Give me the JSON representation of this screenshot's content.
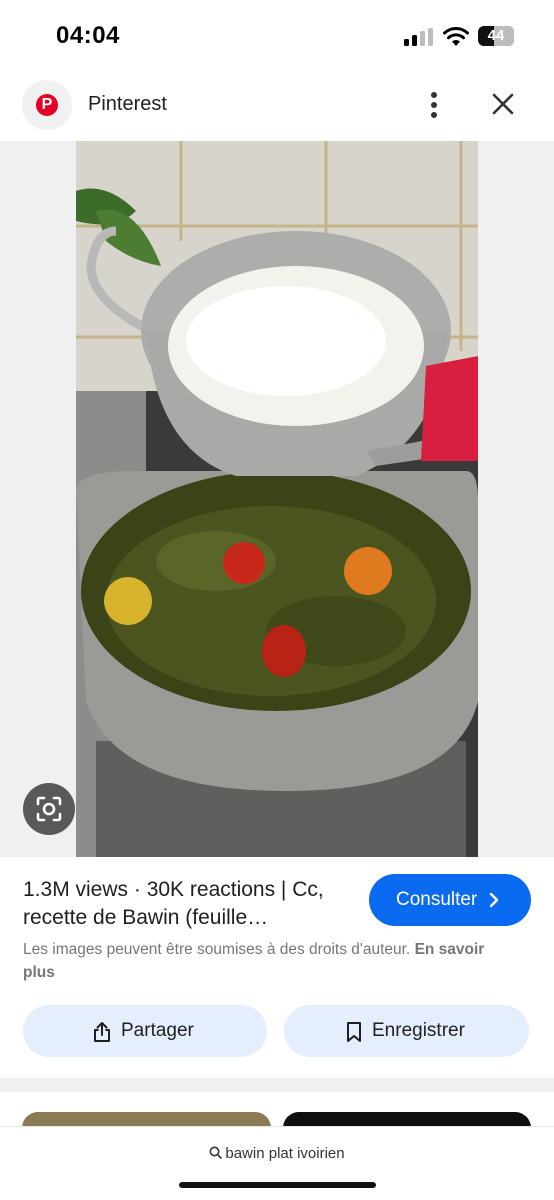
{
  "status_bar": {
    "time": "04:04",
    "battery": "44",
    "battery_level_percent": 44
  },
  "header": {
    "title": "Pinterest",
    "logo_icon": "pinterest-logo-icon",
    "menu_icon": "more-vertical-icon",
    "close_icon": "close-icon"
  },
  "image": {
    "description_icon": "visual-search-lens-icon"
  },
  "pin": {
    "title": "1.3M views · 30K reactions | Cc, recette de Bawin (feuille…",
    "consult_label": "Consulter",
    "copyright_text": "Les images peuvent être soumises à des droits d'auteur.",
    "learn_more_label": "En savoir plus"
  },
  "actions": {
    "share_label": "Partager",
    "save_label": "Enregistrer"
  },
  "search": {
    "query": "bawin plat ivoirien"
  },
  "colors": {
    "accent": "#0a6bf0",
    "brand": "#e60023",
    "action_bg": "#e5eefc"
  }
}
